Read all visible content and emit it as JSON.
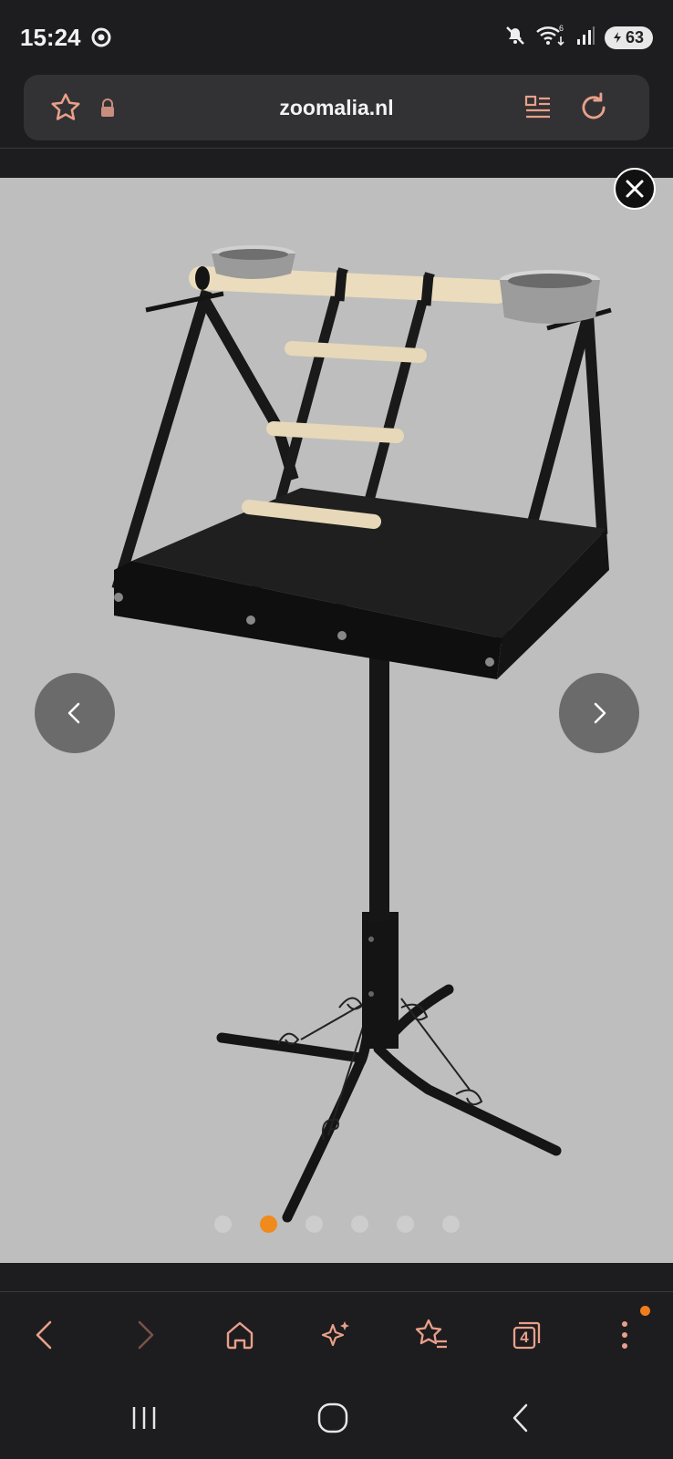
{
  "status_bar": {
    "time": "15:24",
    "battery_level": "63",
    "icons": [
      "chrome-icon",
      "mute-icon",
      "wifi-icon",
      "signal-icon",
      "battery-icon"
    ]
  },
  "address_bar": {
    "url": "zoomalia.nl",
    "icons": [
      "bookmark-star-icon",
      "lock-icon",
      "reader-mode-icon",
      "reload-icon"
    ]
  },
  "gallery": {
    "product": "bird playstand with tray, ladder, two feeding bowls and tripod base",
    "total_images": 6,
    "active_index": 1,
    "controls": [
      "close-icon",
      "previous-arrow-icon",
      "next-arrow-icon"
    ]
  },
  "browser_toolbar": {
    "buttons": [
      "back-icon",
      "forward-icon",
      "home-icon",
      "ai-sparkle-icon",
      "bookmarks-icon",
      "tabs-icon",
      "menu-icon"
    ],
    "tab_count": "4"
  },
  "system_nav": {
    "buttons": [
      "recents-icon",
      "home-circle-icon",
      "system-back-icon"
    ]
  },
  "colors": {
    "accent": "#f08a1c",
    "background": "#1d1d1f",
    "url_bar": "#323234",
    "gallery_bg": "#bebebe"
  }
}
